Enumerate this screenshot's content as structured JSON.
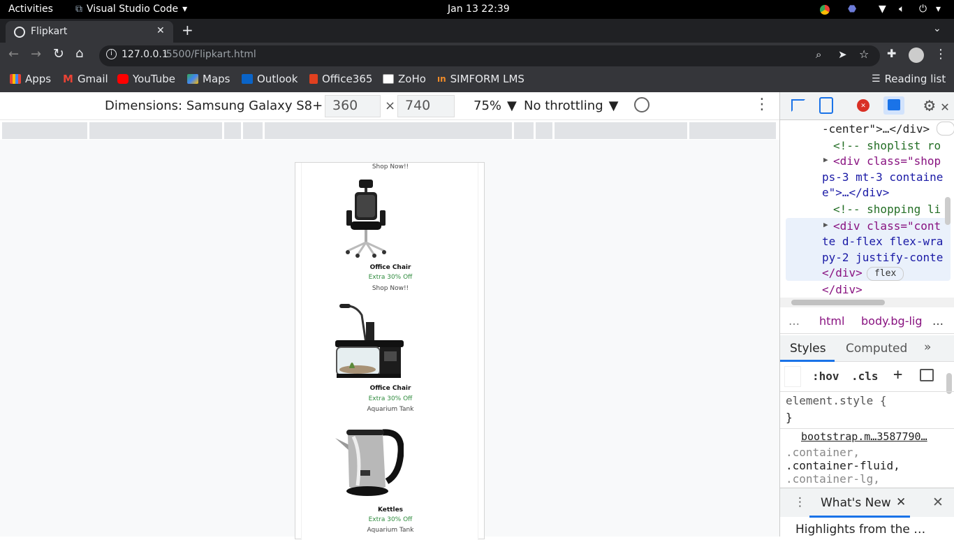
{
  "system": {
    "activities": "Activities",
    "app": "Visual Studio Code",
    "clock": "Jan 13  22:39"
  },
  "browser": {
    "tab_title": "Flipkart",
    "url_host": "127.0.0.1",
    "url_rest": ":5500/Flipkart.html",
    "bookmarks": [
      "Apps",
      "Gmail",
      "YouTube",
      "Maps",
      "Outlook",
      "Office365",
      "ZoHo",
      "SIMFORM LMS"
    ],
    "reading_list": "Reading list"
  },
  "device_toolbar": {
    "dimensions": "Dimensions: Samsung Galaxy S8+",
    "width": "360",
    "times": "×",
    "height": "740",
    "zoom": "75%",
    "throttle": "No throttling"
  },
  "page": {
    "top_caption": "Shop Now!!",
    "products": [
      {
        "title": "Office Chair",
        "offer": "Extra 30% Off",
        "caption": "Shop Now!!"
      },
      {
        "title": "Office Chair",
        "offer": "Extra 30% Off",
        "caption": "Aquarium Tank"
      },
      {
        "title": "Kettles",
        "offer": "Extra 30% Off",
        "caption": "Aquarium Tank"
      }
    ]
  },
  "devtools": {
    "elements": [
      "-center\">…</div>",
      "<!-- shoplist ro",
      "<div class=\"shop",
      "ps-3 mt-3 containe",
      "e\">…</div>",
      "<!-- shopping li",
      "<div class=\"cont",
      "te d-flex flex-wra",
      "py-2 justify-conte",
      "</div>",
      "flex",
      "</div>"
    ],
    "breadcrumb": [
      "…",
      "html",
      "body.bg-lig",
      "…"
    ],
    "tabs": {
      "styles": "Styles",
      "computed": "Computed",
      "more": "»"
    },
    "hov": ":hov",
    "cls": ".cls",
    "element_style": "element.style {",
    "close_brace": "}",
    "source": "bootstrap.m…3587790…",
    "rules": [
      ".container,",
      ".container-fluid,",
      ".container-lg,"
    ],
    "drawer_tab": "What's New",
    "drawer_text": "Highlights from the …"
  }
}
